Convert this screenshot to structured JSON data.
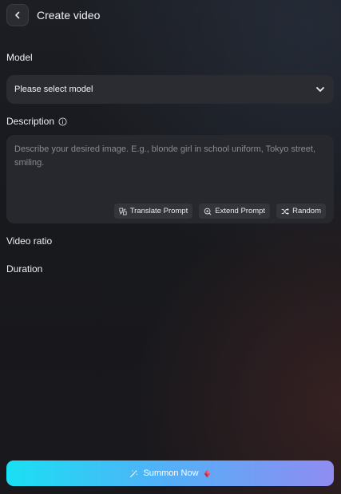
{
  "header": {
    "title": "Create video",
    "back_icon": "chevron-left-icon"
  },
  "model": {
    "label": "Model",
    "selected": "Please select model",
    "dropdown_icon": "chevron-down-icon"
  },
  "description": {
    "label": "Description",
    "info_icon": "info-icon",
    "placeholder": "Describe your desired image. E.g., blonde girl in school uniform, Tokyo street, smiling.",
    "value": "",
    "actions": [
      {
        "label": "Translate Prompt",
        "icon": "translate-icon"
      },
      {
        "label": "Extend Prompt",
        "icon": "extend-icon"
      },
      {
        "label": "Random",
        "icon": "shuffle-icon"
      }
    ]
  },
  "video_ratio": {
    "label": "Video ratio"
  },
  "duration": {
    "label": "Duration"
  },
  "summon": {
    "label": "Summon Now",
    "icon": "magic-wand-icon",
    "credit_icon": "gem-icon"
  },
  "colors": {
    "background": "#1a1b20",
    "panel": "#2b2c31",
    "button_gradient_start": "#19e0f3",
    "button_gradient_end": "#8f8cf2",
    "gem": "#e0456b"
  }
}
